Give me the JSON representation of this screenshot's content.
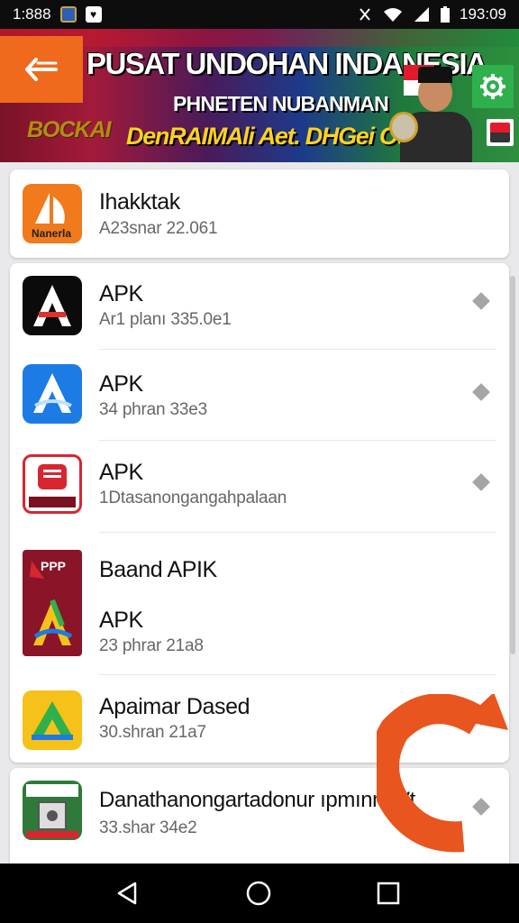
{
  "status_bar": {
    "left_text": "1:888",
    "time": "193:09"
  },
  "banner": {
    "title": "PUSAT UNDOHAN INDANESIA",
    "subtitle": "PHNETEN NUBANMAN",
    "left_tag": "BOCKAI",
    "tagline": "DenRAIMAli Aet. DHGei Ouveea!"
  },
  "top_item": {
    "icon_text": "Nanerla",
    "title": "Ihakktak",
    "subtitle": "A23snar 22.061"
  },
  "list": [
    {
      "title": "APK",
      "subtitle": "Ar1 planı 335.0e1"
    },
    {
      "title": "APK",
      "subtitle": "34 phran 33e3"
    },
    {
      "title": "APK",
      "subtitle": "1Dtasanongangahpalaan"
    },
    {
      "heading": "Baand APIK",
      "title": "APK",
      "subtitle": "23 phrar 21a8",
      "icon_text": "PPP"
    },
    {
      "title": "Apaimar Dased",
      "subtitle": "30.shran 21a7"
    }
  ],
  "bottom_item": {
    "title": "Danathanongartadonur ıpmınm Vt",
    "subtitle": "33.shar 34e2"
  },
  "colors": {
    "accent_orange": "#ef6a1c",
    "settings_green": "#2fb04d",
    "refresh_orange": "#e8551e"
  },
  "icons": {
    "back": "back-arrow-icon",
    "settings": "gear-icon",
    "chevron": "chevron-right-icon",
    "nav_back": "nav-back-icon",
    "nav_home": "nav-home-icon",
    "nav_recents": "nav-recents-icon",
    "refresh": "refresh-icon"
  }
}
